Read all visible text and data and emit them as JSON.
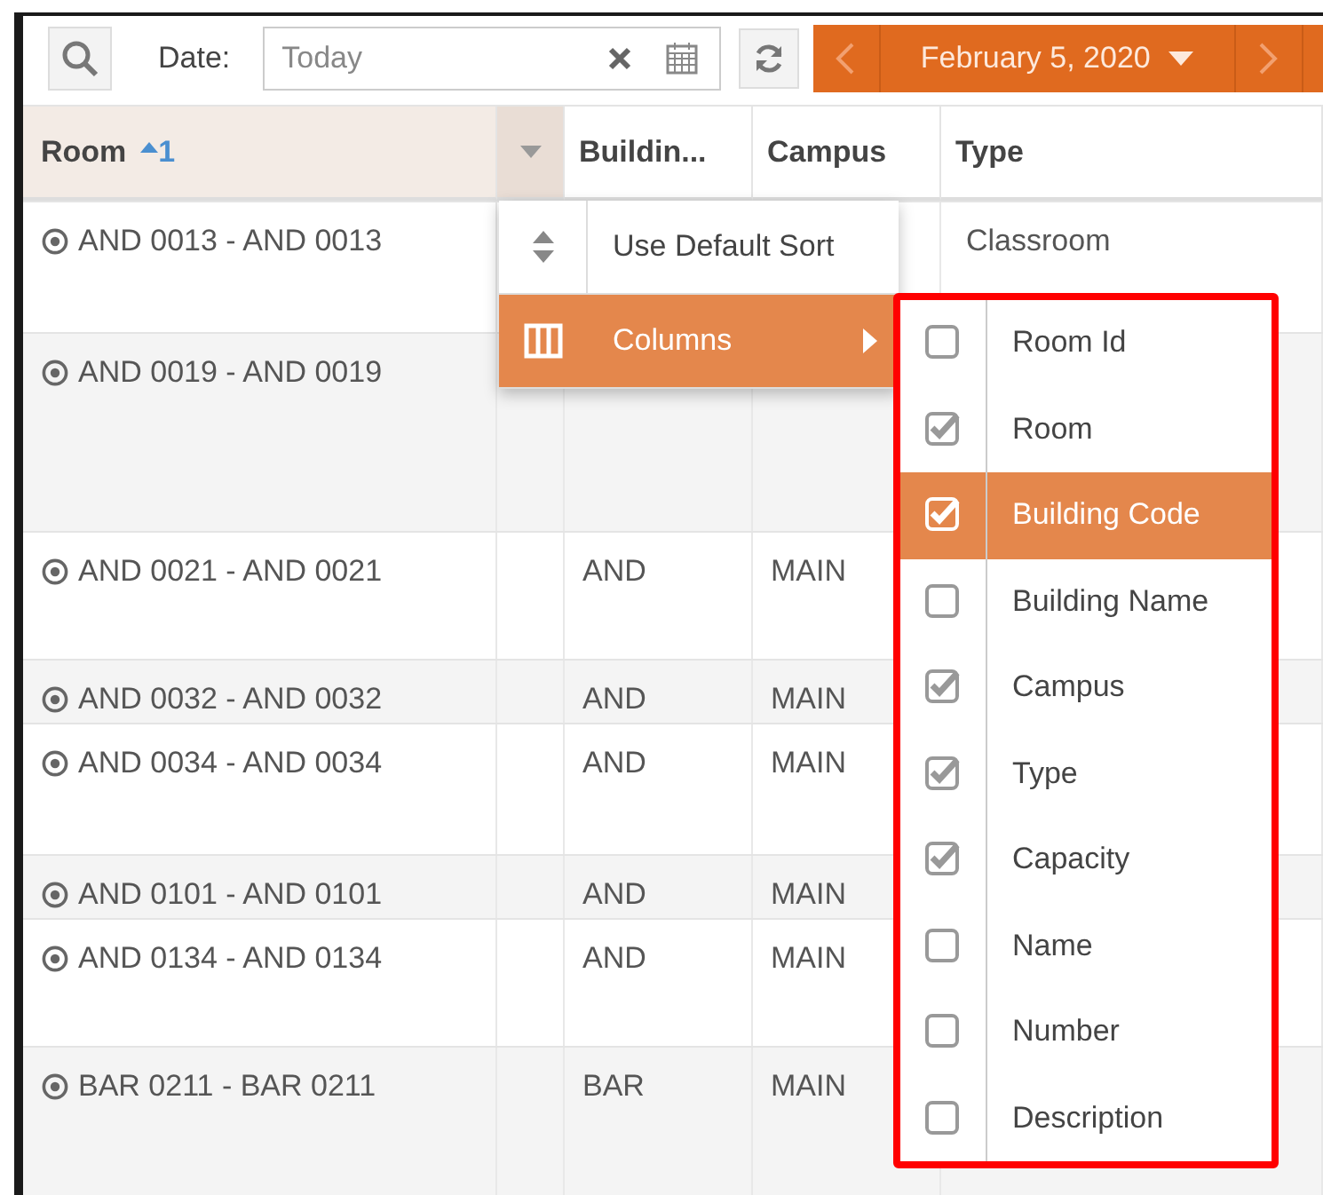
{
  "toolbar": {
    "date_label": "Date:",
    "date_field": {
      "placeholder": "Today"
    },
    "date_nav": {
      "current": "February 5, 2020"
    }
  },
  "table": {
    "columns": [
      {
        "label": "Room",
        "sort_order": "1"
      },
      {
        "label": "Buildin..."
      },
      {
        "label": "Campus"
      },
      {
        "label": "Type"
      }
    ],
    "rows": [
      {
        "room": "AND 0013 - AND 0013",
        "type": "Classroom"
      },
      {
        "room": "AND 0019 - AND 0019"
      },
      {
        "room": "AND 0021 - AND 0021",
        "building": "AND",
        "campus": "MAIN"
      },
      {
        "room": "AND 0032 - AND 0032",
        "building": "AND",
        "campus": "MAIN"
      },
      {
        "room": "AND 0034 - AND 0034",
        "building": "AND",
        "campus": "MAIN"
      },
      {
        "room": "AND 0101 - AND 0101",
        "building": "AND",
        "campus": "MAIN"
      },
      {
        "room": "AND 0134 - AND 0134",
        "building": "AND",
        "campus": "MAIN"
      },
      {
        "room": "BAR 0211 - BAR 0211",
        "building": "BAR",
        "campus": "MAIN"
      }
    ]
  },
  "column_menu": {
    "items": [
      {
        "label": "Use Default Sort",
        "kind": "sort",
        "selected": false
      },
      {
        "label": "Columns",
        "kind": "submenu",
        "selected": true
      }
    ]
  },
  "columns_submenu": {
    "items": [
      {
        "label": "Room Id",
        "checked": false,
        "selected": false
      },
      {
        "label": "Room",
        "checked": true,
        "selected": false
      },
      {
        "label": "Building Code",
        "checked": true,
        "selected": true
      },
      {
        "label": "Building Name",
        "checked": false,
        "selected": false
      },
      {
        "label": "Campus",
        "checked": true,
        "selected": false
      },
      {
        "label": "Type",
        "checked": true,
        "selected": false
      },
      {
        "label": "Capacity",
        "checked": true,
        "selected": false
      },
      {
        "label": "Name",
        "checked": false,
        "selected": false
      },
      {
        "label": "Number",
        "checked": false,
        "selected": false
      },
      {
        "label": "Description",
        "checked": false,
        "selected": false
      }
    ]
  }
}
